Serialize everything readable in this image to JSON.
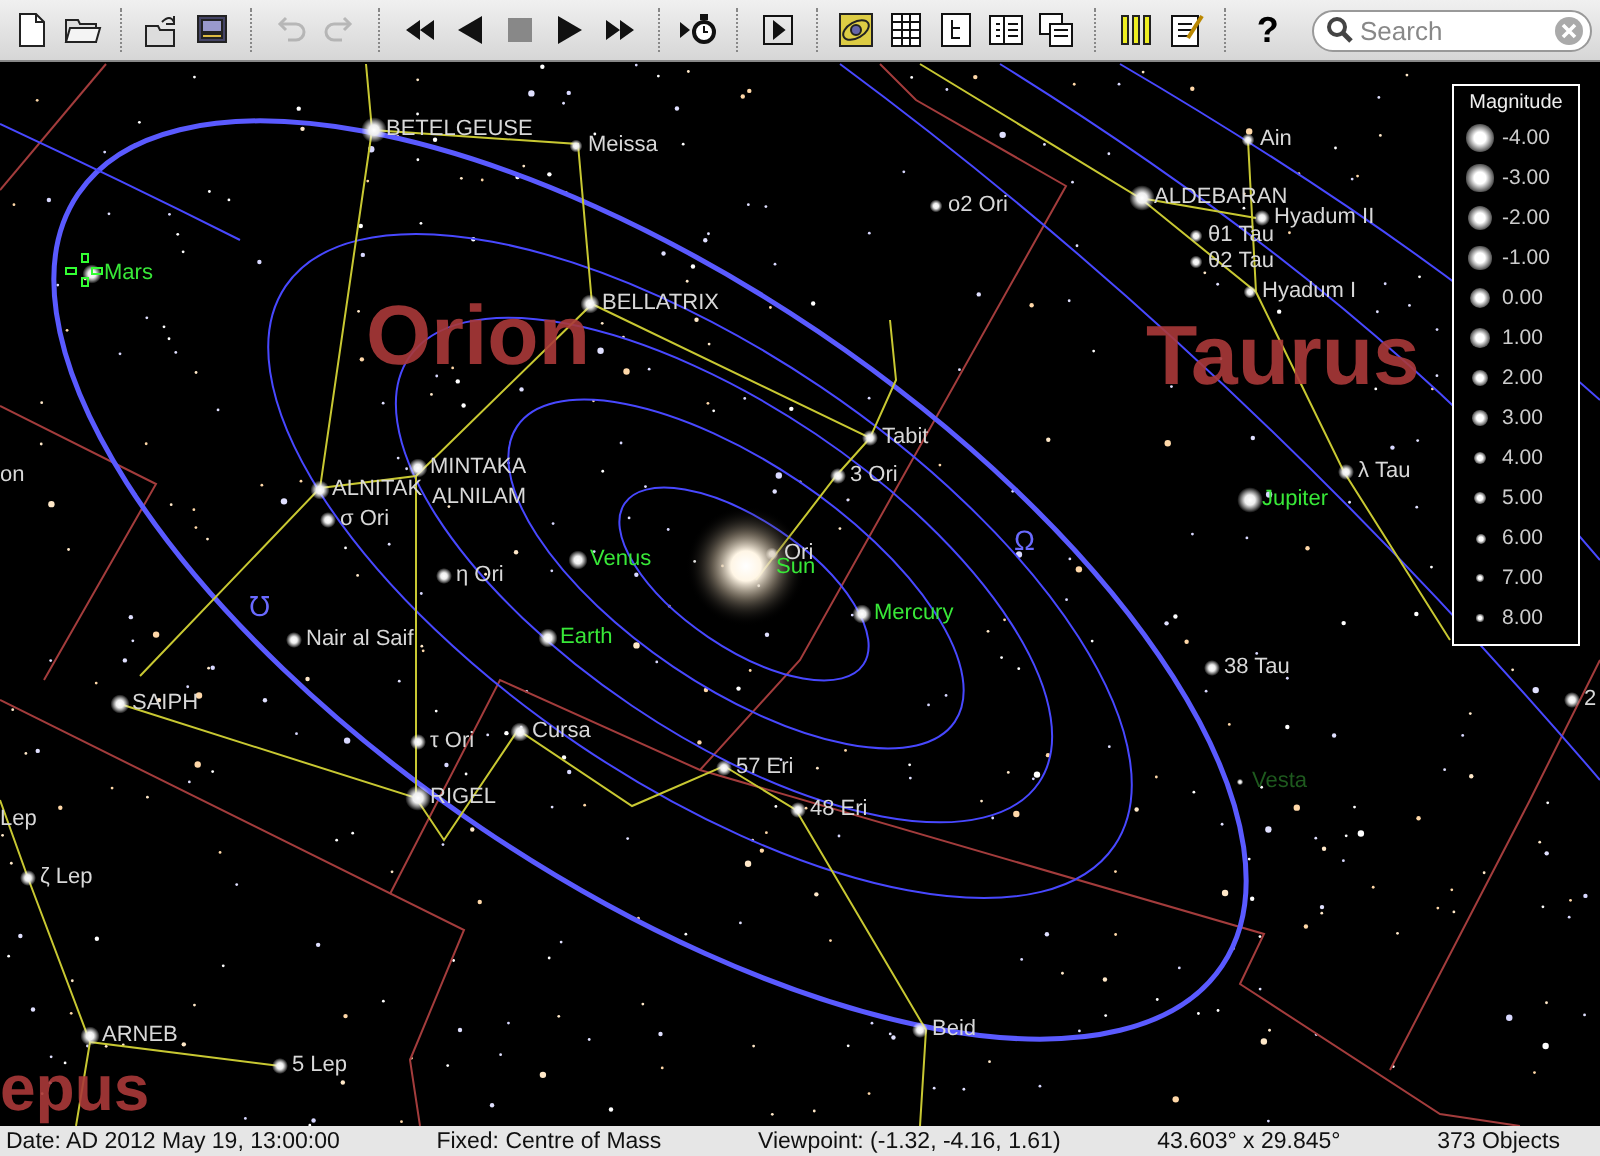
{
  "toolbar": {
    "buttons": [
      {
        "kind": "new",
        "disabled": false
      },
      {
        "kind": "open",
        "disabled": false
      },
      {
        "kind": "sep"
      },
      {
        "kind": "export",
        "disabled": false
      },
      {
        "kind": "screen",
        "disabled": false
      },
      {
        "kind": "sep"
      },
      {
        "kind": "undo",
        "disabled": true
      },
      {
        "kind": "redo",
        "disabled": true
      },
      {
        "kind": "sep"
      },
      {
        "kind": "rewind",
        "disabled": false
      },
      {
        "kind": "back",
        "disabled": false
      },
      {
        "kind": "stop",
        "disabled": false
      },
      {
        "kind": "play",
        "disabled": false
      },
      {
        "kind": "forward",
        "disabled": false
      },
      {
        "kind": "sep"
      },
      {
        "kind": "timer",
        "disabled": false
      },
      {
        "kind": "sep"
      },
      {
        "kind": "present",
        "disabled": false
      },
      {
        "kind": "sep"
      },
      {
        "kind": "orbit",
        "disabled": false
      },
      {
        "kind": "table",
        "disabled": false
      },
      {
        "kind": "tree",
        "disabled": false
      },
      {
        "kind": "columns",
        "disabled": false
      },
      {
        "kind": "windows",
        "disabled": false
      },
      {
        "kind": "sep"
      },
      {
        "kind": "bars",
        "disabled": false
      },
      {
        "kind": "notes",
        "disabled": false
      },
      {
        "kind": "sep"
      }
    ],
    "help": "?",
    "search": {
      "placeholder": "Search"
    }
  },
  "sky_map": {
    "labels": [
      {
        "text": "BETELGEUSE",
        "kind": "star"
      },
      {
        "text": "Meissa",
        "kind": "star"
      },
      {
        "text": "Mars",
        "kind": "planet"
      },
      {
        "text": "BELLATRIX",
        "kind": "star"
      },
      {
        "text": "Orion",
        "kind": "constellation"
      },
      {
        "text": "Ain",
        "kind": "star"
      },
      {
        "text": "ALDEBARAN",
        "kind": "star"
      },
      {
        "text": "Hyadum II",
        "kind": "star"
      },
      {
        "text": "θ1 Tau",
        "kind": "star"
      },
      {
        "text": "θ2 Tau",
        "kind": "star"
      },
      {
        "text": "o2 Ori",
        "kind": "star"
      },
      {
        "text": "Hyadum I",
        "kind": "star"
      },
      {
        "text": "Taurus",
        "kind": "constellation"
      },
      {
        "text": "Tabit",
        "kind": "star"
      },
      {
        "text": "3 Ori",
        "kind": "star"
      },
      {
        "text": "ALNITAK",
        "kind": "star"
      },
      {
        "text": "MINTAKA",
        "kind": "star"
      },
      {
        "text": "ALNILAM",
        "kind": "star"
      },
      {
        "text": "σ Ori",
        "kind": "star"
      },
      {
        "text": "η Ori",
        "kind": "star"
      },
      {
        "text": "Venus",
        "kind": "planet"
      },
      {
        "text": "Ori",
        "kind": "star"
      },
      {
        "text": "Sun",
        "kind": "planet"
      },
      {
        "text": "Mercury",
        "kind": "planet"
      },
      {
        "text": "Earth",
        "kind": "planet"
      },
      {
        "text": "Nair al Saif",
        "kind": "star"
      },
      {
        "text": "Ω",
        "kind": "node"
      },
      {
        "text": "℧",
        "kind": "node"
      },
      {
        "text": "Jupiter",
        "kind": "planet"
      },
      {
        "text": "λ Tau",
        "kind": "star"
      },
      {
        "text": "38 Tau",
        "kind": "star"
      },
      {
        "text": "on",
        "kind": "star"
      },
      {
        "text": "SAIPH",
        "kind": "star"
      },
      {
        "text": "τ Ori",
        "kind": "star"
      },
      {
        "text": "RIGEL",
        "kind": "star"
      },
      {
        "text": "Cursa",
        "kind": "star"
      },
      {
        "text": "57 Eri",
        "kind": "star"
      },
      {
        "text": "48 Eri",
        "kind": "star"
      },
      {
        "text": "Lep",
        "kind": "star"
      },
      {
        "text": "ζ Lep",
        "kind": "star"
      },
      {
        "text": "ARNEB",
        "kind": "star"
      },
      {
        "text": "5 Lep",
        "kind": "star"
      },
      {
        "text": "Beid",
        "kind": "star"
      },
      {
        "text": "Vesta",
        "kind": "faint-planet"
      },
      {
        "text": "epus",
        "kind": "constellation"
      },
      {
        "text": "2",
        "kind": "star"
      }
    ],
    "legend": {
      "title": "Magnitude",
      "entries": [
        "-4.00",
        "-3.00",
        "-2.00",
        "-1.00",
        "0.00",
        "1.00",
        "2.00",
        "3.00",
        "4.00",
        "5.00",
        "6.00",
        "7.00",
        "8.00"
      ]
    }
  },
  "status_bar": [
    "Date: AD 2012 May 19, 13:00:00",
    "Fixed: Centre of Mass",
    "Viewpoint: (-1.32, -4.16, 1.61)",
    "43.603° x 29.845°",
    "373 Objects"
  ]
}
